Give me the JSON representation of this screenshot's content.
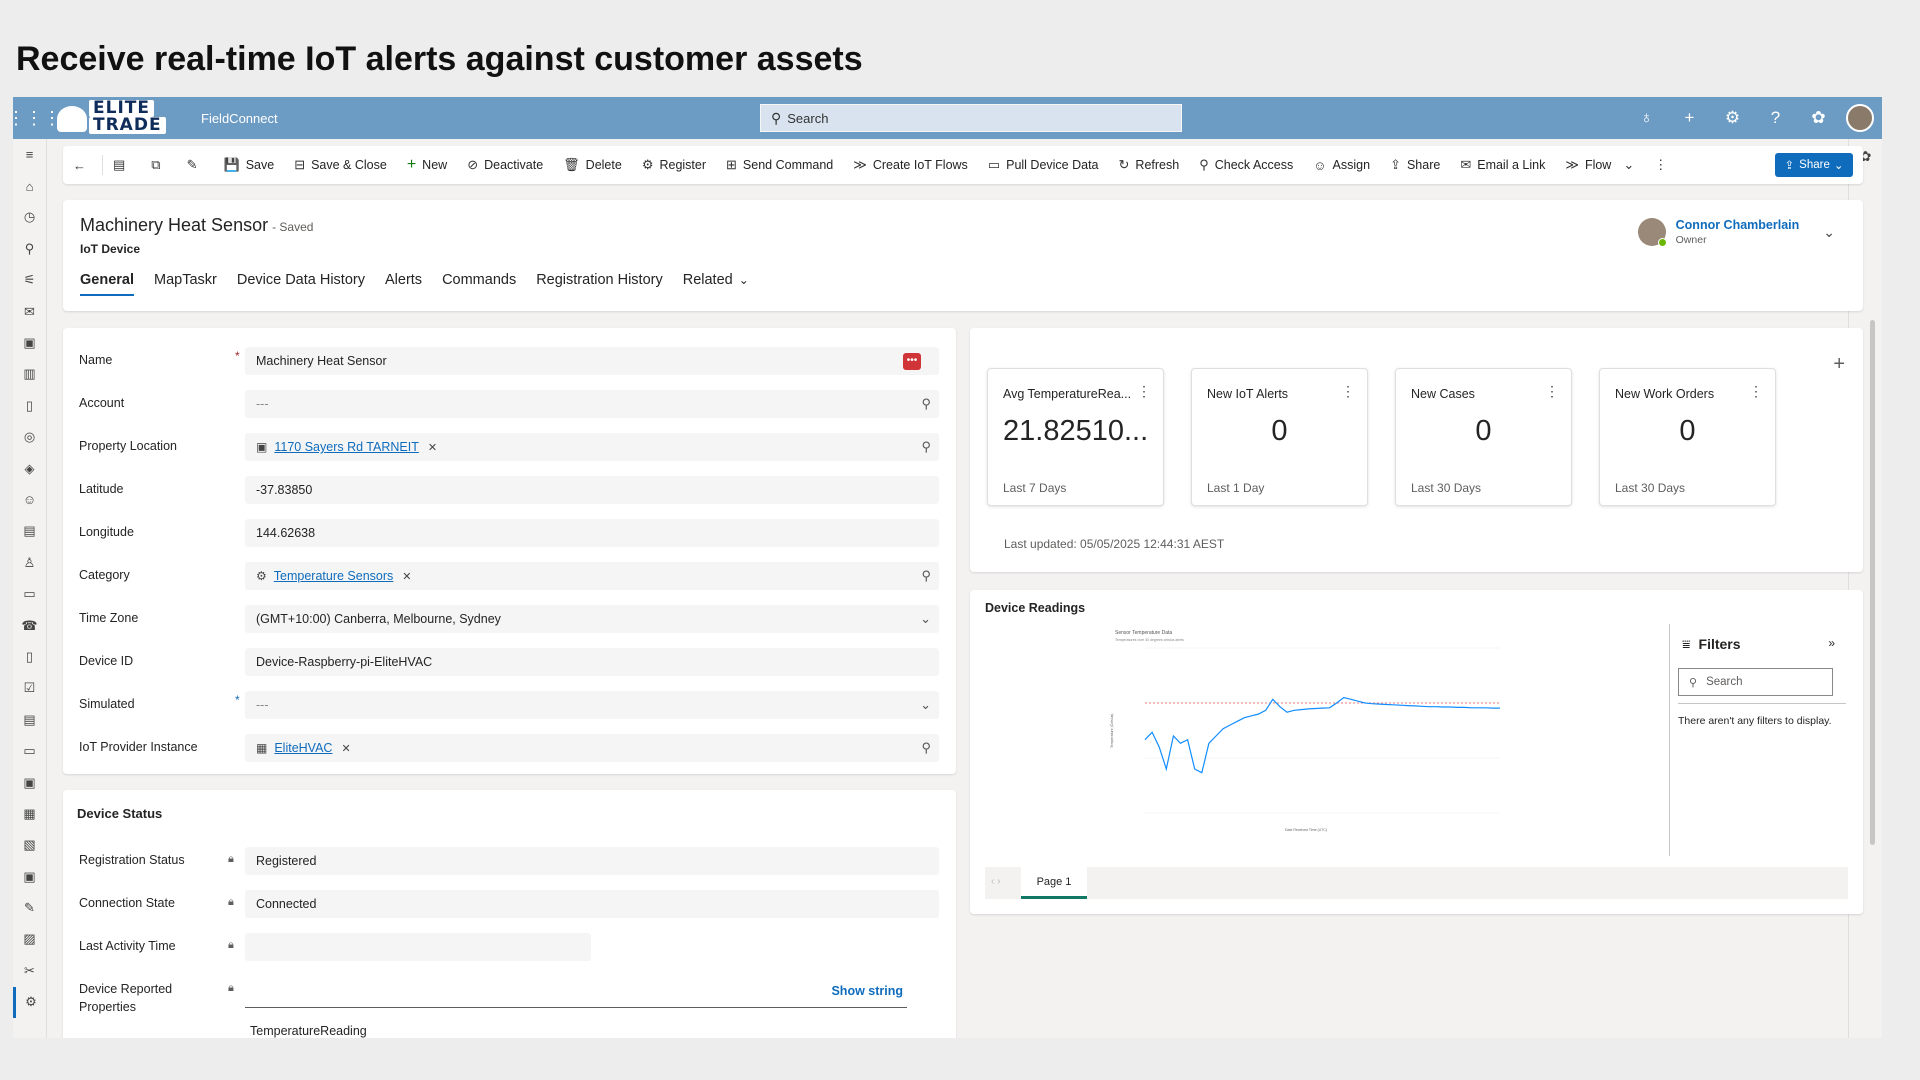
{
  "slide_title": "Receive real-time IoT alerts against customer assets",
  "topbar": {
    "logo_line1": "ELITE",
    "logo_line2": "TRADE",
    "app_name": "FieldConnect",
    "search_placeholder": "Search",
    "icons": [
      "lightbulb-icon",
      "plus-icon",
      "gear-icon",
      "help-icon",
      "copilot-icon"
    ]
  },
  "sidebar": {
    "icons": [
      "hamburger-icon",
      "home-icon",
      "recent-icon",
      "pin-icon",
      "dashboard-icon",
      "mail-icon",
      "clipboard-icon",
      "report-icon",
      "document-icon",
      "target-icon",
      "layers-icon",
      "person-icon",
      "list-icon",
      "user-edit-icon",
      "page-icon",
      "phone-icon",
      "form-icon",
      "checklist-icon",
      "invoice-icon",
      "book-icon",
      "clipboard-check-icon",
      "calendar-icon",
      "search-doc-icon",
      "task-icon",
      "wrench-icon",
      "doc-search-icon",
      "tools-icon",
      "iot-device-icon"
    ]
  },
  "commands": [
    {
      "label": "",
      "icon": "←"
    },
    {
      "label": "",
      "icon": "▤"
    },
    {
      "label": "",
      "icon": "⧉"
    },
    {
      "label": "",
      "icon": "✎"
    },
    {
      "label": "Save",
      "icon": "💾"
    },
    {
      "label": "Save & Close",
      "icon": "⊟"
    },
    {
      "label": "New",
      "icon": "+"
    },
    {
      "label": "Deactivate",
      "icon": "⊘"
    },
    {
      "label": "Delete",
      "icon": "🗑"
    },
    {
      "label": "Register",
      "icon": "⚙"
    },
    {
      "label": "Send Command",
      "icon": "⊞"
    },
    {
      "label": "Create IoT Flows",
      "icon": "≫"
    },
    {
      "label": "Pull Device Data",
      "icon": "▭"
    },
    {
      "label": "Refresh",
      "icon": "↻"
    },
    {
      "label": "Check Access",
      "icon": "⚲"
    },
    {
      "label": "Assign",
      "icon": "☺"
    },
    {
      "label": "Share",
      "icon": "⇪"
    },
    {
      "label": "Email a Link",
      "icon": "✉"
    },
    {
      "label": "Flow",
      "icon": "≫"
    }
  ],
  "share_button": "Share",
  "header": {
    "title": "Machinery Heat Sensor",
    "saved": "- Saved",
    "entity": "IoT Device",
    "owner_name": "Connor Chamberlain",
    "owner_role": "Owner",
    "tabs": [
      "General",
      "MapTaskr",
      "Device Data History",
      "Alerts",
      "Commands",
      "Registration History",
      "Related"
    ]
  },
  "general": {
    "name_label": "Name",
    "name_value": "Machinery Heat Sensor",
    "account_label": "Account",
    "account_value": "---",
    "property_label": "Property Location",
    "property_value": "1170 Sayers Rd TARNEIT",
    "latitude_label": "Latitude",
    "latitude_value": "-37.83850",
    "longitude_label": "Longitude",
    "longitude_value": "144.62638",
    "category_label": "Category",
    "category_value": "Temperature Sensors",
    "timezone_label": "Time Zone",
    "timezone_value": "(GMT+10:00) Canberra, Melbourne, Sydney",
    "deviceid_label": "Device ID",
    "deviceid_value": "Device-Raspberry-pi-EliteHVAC",
    "simulated_label": "Simulated",
    "simulated_value": "---",
    "provider_label": "IoT Provider Instance",
    "provider_value": "EliteHVAC"
  },
  "device_status": {
    "heading": "Device Status",
    "reg_label": "Registration Status",
    "reg_value": "Registered",
    "conn_label": "Connection State",
    "conn_value": "Connected",
    "activity_label": "Last Activity Time",
    "activity_value": "",
    "reported_label": "Device Reported Properties",
    "show_string": "Show string",
    "reported_value": "TemperatureReading"
  },
  "kpis": [
    {
      "title": "Avg TemperatureRea...",
      "value": "21.82510...",
      "sub": "Last 7 Days"
    },
    {
      "title": "New IoT Alerts",
      "value": "0",
      "sub": "Last 1 Day"
    },
    {
      "title": "New Cases",
      "value": "0",
      "sub": "Last 30 Days"
    },
    {
      "title": "New Work Orders",
      "value": "0",
      "sub": "Last 30 Days"
    }
  ],
  "last_updated": "Last updated: 05/05/2025 12:44:31 AEST",
  "readings": {
    "heading": "Device Readings",
    "filters_title": "Filters",
    "filters_search": "Search",
    "filters_empty": "There aren't any filters to display.",
    "page_tab": "Page 1"
  },
  "chart_data": {
    "type": "line",
    "title": "Sensor Temperature Data",
    "subtitle": "Temperatures over 30 degrees celsius alerts",
    "xlabel": "Date Received Time (UTC)",
    "ylabel": "Temperature (Celsius)",
    "x": [
      0,
      2,
      4,
      6,
      8,
      10,
      12,
      14,
      16,
      18,
      20,
      22,
      24,
      26,
      28,
      30,
      32,
      34,
      36,
      38,
      40,
      42,
      44,
      46,
      48,
      50,
      52,
      54,
      56,
      58,
      60,
      62,
      64,
      66,
      68,
      70,
      72,
      74,
      76,
      78,
      80,
      82,
      84,
      86,
      88,
      90,
      92,
      94,
      96,
      98,
      100
    ],
    "series": [
      {
        "values": [
          20,
          22,
          18,
          12,
          21,
          19,
          20,
          12,
          11,
          19,
          21,
          23,
          24,
          25,
          26,
          26.5,
          27,
          28,
          31,
          29,
          27.5,
          28,
          28.2,
          28.4,
          28.5,
          28.6,
          28.7,
          30,
          31.5,
          31,
          30.5,
          30,
          29.8,
          29.7,
          29.6,
          29.5,
          29.4,
          29.3,
          29.2,
          29.1,
          29.0,
          29.0,
          28.9,
          28.9,
          28.8,
          28.8,
          28.7,
          28.7,
          28.7,
          28.6,
          28.6
        ]
      }
    ],
    "threshold": 30,
    "ylim": [
      0,
      45
    ],
    "colors": {
      "line": "#118dff",
      "threshold": "#e05757"
    }
  }
}
